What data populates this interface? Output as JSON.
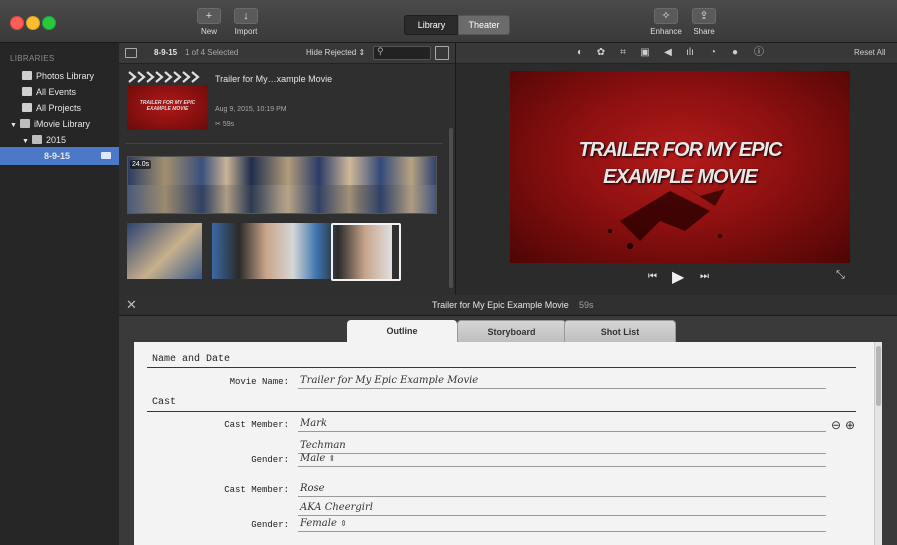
{
  "toolbar": {
    "new_label": "New",
    "import_label": "Import",
    "library_label": "Library",
    "theater_label": "Theater",
    "enhance_label": "Enhance",
    "share_label": "Share"
  },
  "sidebar": {
    "heading": "LIBRARIES",
    "items": [
      {
        "label": "Photos Library"
      },
      {
        "label": "All Events"
      },
      {
        "label": "All Projects"
      },
      {
        "label": "iMovie Library"
      },
      {
        "label": "2015"
      },
      {
        "label": "8-9-15"
      }
    ]
  },
  "browser": {
    "event_name": "8-9-15",
    "selection": "1 of 4 Selected",
    "filter": "Hide Rejected",
    "project": {
      "title": "Trailer for My…xample Movie",
      "date": "Aug 9, 2015, 10:19 PM",
      "duration": "59s",
      "thumb_text": "TRAILER FOR MY EPIC EXAMPLE MOVIE"
    },
    "clip_duration": "24.0s"
  },
  "viewer": {
    "reset_label": "Reset All",
    "title_line1": "TRAILER FOR MY EPIC",
    "title_line2": "EXAMPLE MOVIE"
  },
  "trailer": {
    "title": "Trailer for My Epic Example Movie",
    "duration": "59s",
    "tabs": [
      "Outline",
      "Storyboard",
      "Shot List"
    ],
    "active_tab": "Outline",
    "sections": {
      "name_date": "Name and Date",
      "cast": "Cast"
    },
    "fields": {
      "movie_name_label": "Movie Name:",
      "movie_name_value": "Trailer for My Epic Example Movie",
      "cast_member_label": "Cast Member:",
      "gender_label": "Gender:",
      "cast1_line1": "Mark",
      "cast1_line2": "Techman",
      "cast1_gender": "Male",
      "cast2_line1": "Rose",
      "cast2_line2": "AKA Cheergirl",
      "cast2_gender": "Female"
    }
  }
}
